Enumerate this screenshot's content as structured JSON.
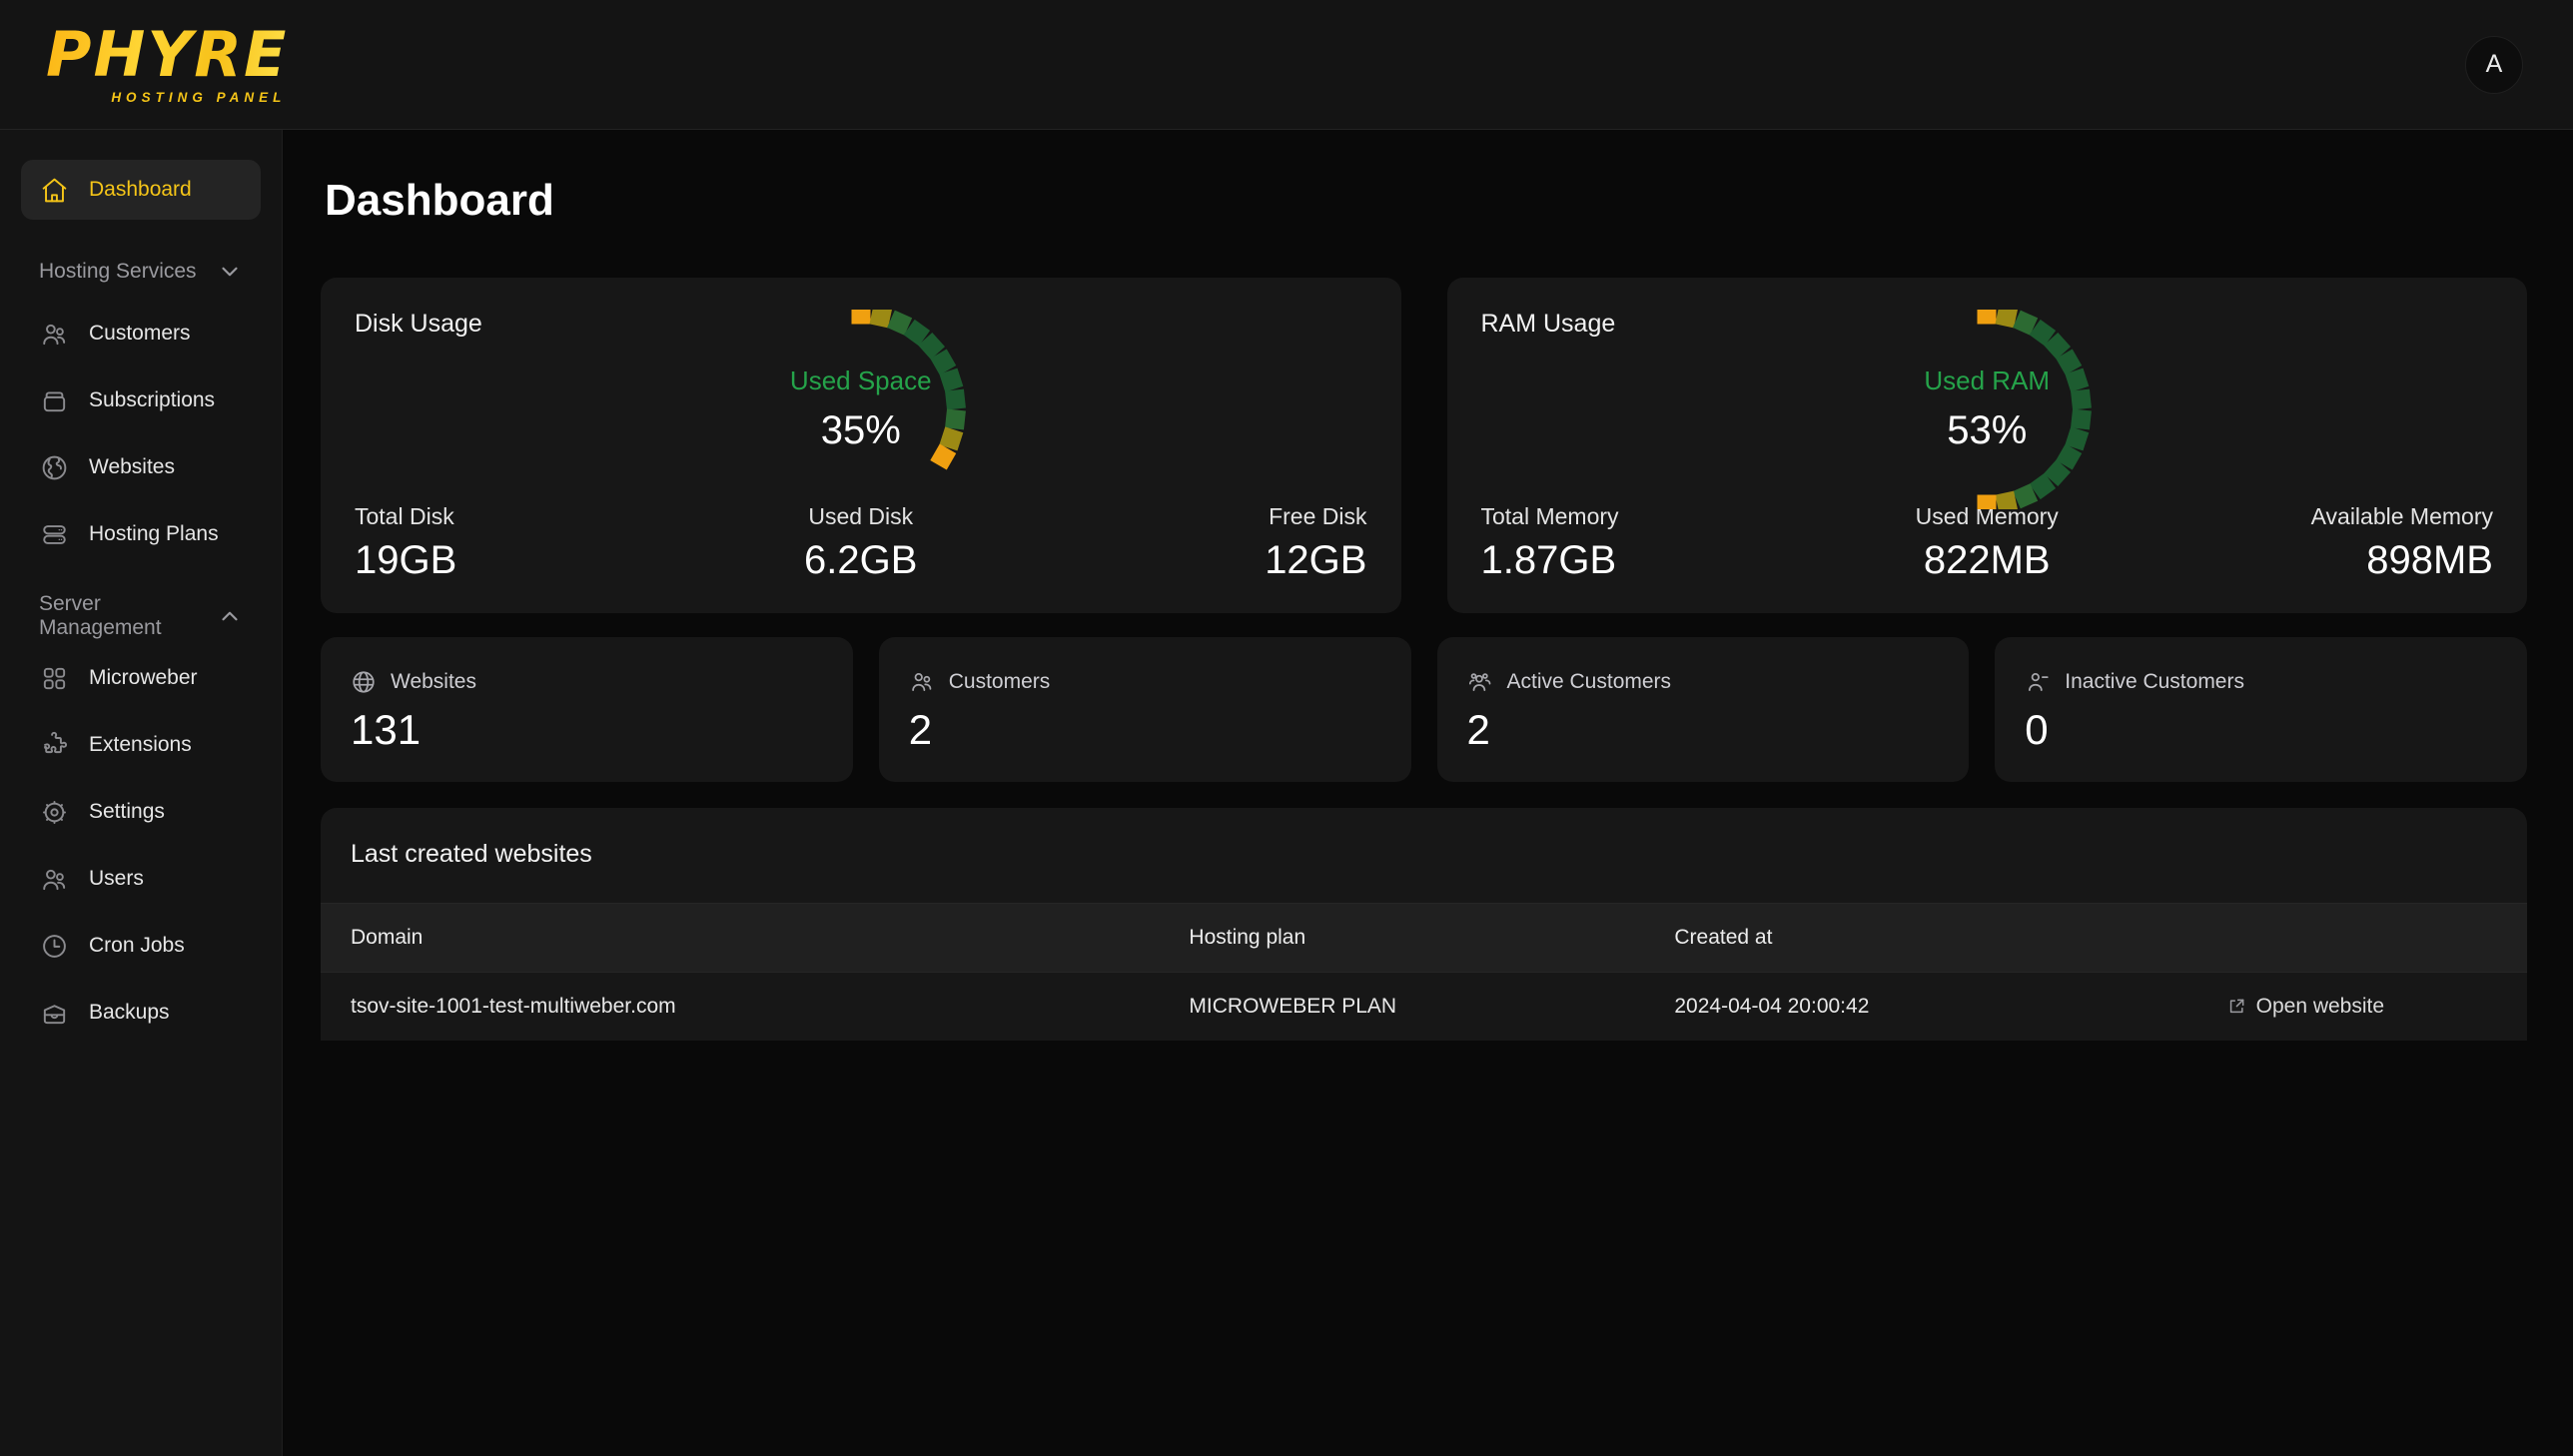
{
  "brand": {
    "name": "PHYRE",
    "tagline": "HOSTING PANEL"
  },
  "topbar": {
    "avatar_initial": "A"
  },
  "sidebar": {
    "dashboard": {
      "label": "Dashboard",
      "icon": "home-icon"
    },
    "sections": [
      {
        "label": "Hosting Services",
        "chevron": "chevron-down-icon",
        "items": [
          {
            "label": "Customers",
            "icon": "users-icon"
          },
          {
            "label": "Subscriptions",
            "icon": "box-icon"
          },
          {
            "label": "Websites",
            "icon": "globe-icon"
          },
          {
            "label": "Hosting Plans",
            "icon": "server-icon"
          }
        ]
      },
      {
        "label": "Server Management",
        "chevron": "chevron-up-icon",
        "items": [
          {
            "label": "Microweber",
            "icon": "grid-icon"
          },
          {
            "label": "Extensions",
            "icon": "puzzle-icon"
          },
          {
            "label": "Settings",
            "icon": "gear-icon"
          },
          {
            "label": "Users",
            "icon": "users-icon"
          },
          {
            "label": "Cron Jobs",
            "icon": "clock-icon"
          },
          {
            "label": "Backups",
            "icon": "archive-icon"
          }
        ]
      }
    ]
  },
  "main": {
    "page_title": "Dashboard",
    "disk": {
      "title": "Disk Usage",
      "gauge_label": "Used Space",
      "gauge_percent": "35%",
      "stats": [
        {
          "label": "Total Disk",
          "value": "19GB"
        },
        {
          "label": "Used Disk",
          "value": "6.2GB"
        },
        {
          "label": "Free Disk",
          "value": "12GB"
        }
      ]
    },
    "ram": {
      "title": "RAM Usage",
      "gauge_label": "Used RAM",
      "gauge_percent": "53%",
      "stats": [
        {
          "label": "Total Memory",
          "value": "1.87GB"
        },
        {
          "label": "Used Memory",
          "value": "822MB"
        },
        {
          "label": "Available Memory",
          "value": "898MB"
        }
      ]
    },
    "stat_cards": [
      {
        "label": "Websites",
        "value": "131",
        "icon": "globe-icon"
      },
      {
        "label": "Customers",
        "value": "2",
        "icon": "users-icon"
      },
      {
        "label": "Active Customers",
        "value": "2",
        "icon": "users-group-icon"
      },
      {
        "label": "Inactive Customers",
        "value": "0",
        "icon": "user-minus-icon"
      }
    ],
    "table": {
      "title": "Last created websites",
      "columns": [
        "Domain",
        "Hosting plan",
        "Created at",
        ""
      ],
      "rows": [
        {
          "domain": "tsov-site-1001-test-multiweber.com",
          "plan": "MICROWEBER PLAN",
          "created_at": "2024-04-04 20:00:42",
          "action": "Open website"
        }
      ]
    }
  },
  "chart_data": [
    {
      "type": "pie",
      "title": "Disk Usage",
      "label": "Used Space",
      "values": [
        35,
        65
      ],
      "categories": [
        "Used",
        "Free"
      ],
      "percent": 35,
      "unit": "%",
      "colors": [
        "#f0a010",
        "#1d5c30"
      ],
      "total_gb": 19,
      "used_gb": 6.2,
      "free_gb": 12
    },
    {
      "type": "pie",
      "title": "RAM Usage",
      "label": "Used RAM",
      "values": [
        53,
        47
      ],
      "categories": [
        "Used",
        "Available"
      ],
      "percent": 53,
      "unit": "%",
      "colors": [
        "#f0a010",
        "#1d5c30"
      ],
      "total_gb": 1.87,
      "used_mb": 822,
      "available_mb": 898
    }
  ]
}
